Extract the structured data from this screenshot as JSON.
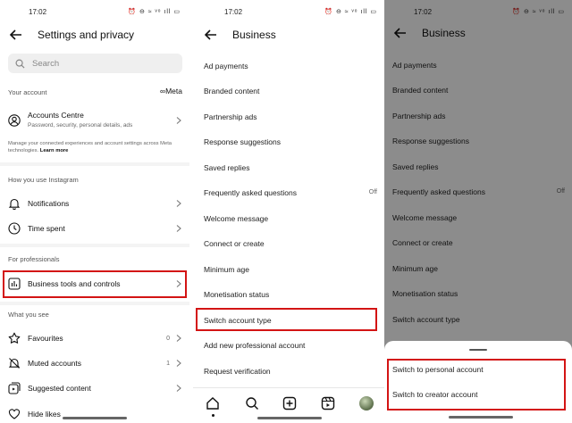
{
  "status_bar": {
    "time": "17:02",
    "icons_text": "⏰ ⊖ ≈ ᵛᵒ ıll ▭"
  },
  "panel1": {
    "title": "Settings and privacy",
    "search_placeholder": "Search",
    "your_account": "Your account",
    "meta_logo": "∞Meta",
    "accounts_centre": "Accounts Centre",
    "accounts_centre_sub": "Password, security, personal details, ads",
    "accounts_note": "Manage your connected experiences and account settings across Meta technologies.",
    "learn_more": "Learn more",
    "how_you_use": "How you use Instagram",
    "notifications": "Notifications",
    "time_spent": "Time spent",
    "for_professionals": "For professionals",
    "business_tools": "Business tools and controls",
    "what_you_see": "What you see",
    "favourites": "Favourites",
    "favourites_count": "0",
    "muted_accounts": "Muted accounts",
    "muted_count": "1",
    "suggested_content": "Suggested content",
    "hide_likes": "Hide likes"
  },
  "panel2": {
    "title": "Business",
    "items": [
      "Ad payments",
      "Branded content",
      "Partnership ads",
      "Response suggestions",
      "Saved replies",
      "Frequently asked questions",
      "Welcome message",
      "Connect or create",
      "Minimum age",
      "Monetisation status",
      "Switch account type",
      "Add new professional account",
      "Request verification"
    ],
    "faq_value": "Off"
  },
  "panel3": {
    "title": "Business",
    "items": [
      "Ad payments",
      "Branded content",
      "Partnership ads",
      "Response suggestions",
      "Saved replies",
      "Frequently asked questions",
      "Welcome message",
      "Connect or create",
      "Minimum age",
      "Monetisation status",
      "Switch account type"
    ],
    "faq_value": "Off",
    "sheet_items": [
      "Switch to personal account",
      "Switch to creator account"
    ]
  },
  "colors": {
    "highlight": "#d31414",
    "dim_overlay": "rgba(0,0,0,0.45)",
    "meta_blue": "#0866ff"
  }
}
